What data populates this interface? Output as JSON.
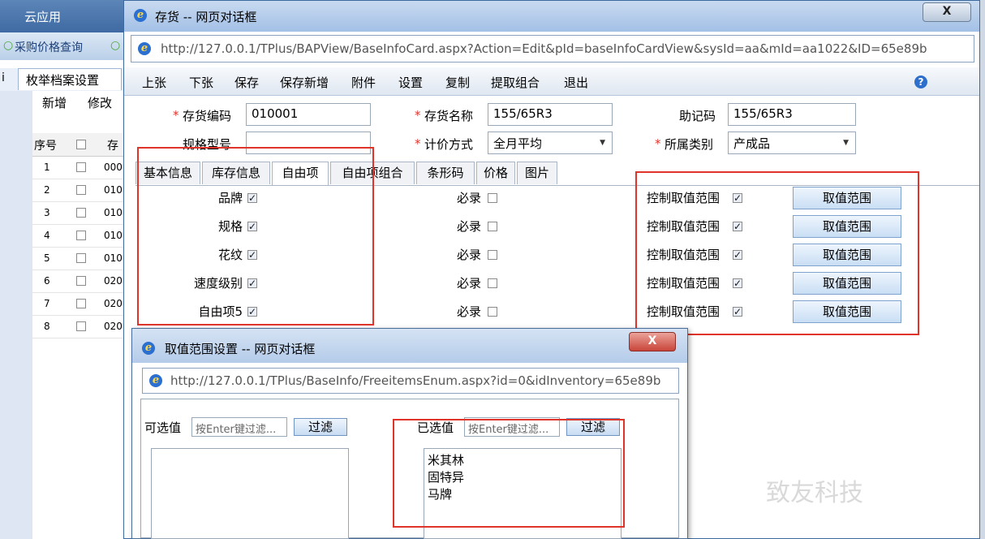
{
  "background_app": {
    "title": "云应用",
    "tab1": "采购价格查询",
    "tab2": "○",
    "left_label": "i",
    "subtab": "枚举档案设置",
    "actions": [
      "新增",
      "修改"
    ],
    "grid_header": {
      "seq": "序号",
      "code": "存"
    },
    "rows": [
      {
        "seq": "1",
        "code": "000"
      },
      {
        "seq": "2",
        "code": "010"
      },
      {
        "seq": "3",
        "code": "010"
      },
      {
        "seq": "4",
        "code": "010"
      },
      {
        "seq": "5",
        "code": "010"
      },
      {
        "seq": "6",
        "code": "020"
      },
      {
        "seq": "7",
        "code": "020"
      },
      {
        "seq": "8",
        "code": "020"
      }
    ]
  },
  "dialog": {
    "title": "存货 -- 网页对话框",
    "close_label": "X",
    "url": "http://127.0.0.1/TPlus/BAPView/BaseInfoCard.aspx?Action=Edit&pId=baseInfoCardView&sysId=aa&mId=aa1022&ID=65e89b",
    "toolbar": [
      "上张",
      "下张",
      "保存",
      "保存新增",
      "附件",
      "设置",
      "复制",
      "提取组合",
      "退出"
    ],
    "help": "?",
    "form": {
      "code_label": "存货编码",
      "code_value": "010001",
      "name_label": "存货名称",
      "name_value": "155/65R3",
      "mnemonic_label": "助记码",
      "mnemonic_value": "155/65R3",
      "spec_label": "规格型号",
      "spec_value": "",
      "valuation_label": "计价方式",
      "valuation_value": "全月平均",
      "category_label": "所属类别",
      "category_value": "产成品",
      "required_mark": "*"
    },
    "tabs": [
      "基本信息",
      "库存信息",
      "自由项",
      "自由项组合",
      "条形码",
      "价格",
      "图片"
    ],
    "active_tab": "自由项",
    "free_items": [
      {
        "name": "品牌",
        "enabled": true,
        "required_label": "必录",
        "required": false,
        "control_label": "控制取值范围",
        "control": true,
        "button": "取值范围"
      },
      {
        "name": "规格",
        "enabled": true,
        "required_label": "必录",
        "required": false,
        "control_label": "控制取值范围",
        "control": true,
        "button": "取值范围"
      },
      {
        "name": "花纹",
        "enabled": true,
        "required_label": "必录",
        "required": false,
        "control_label": "控制取值范围",
        "control": true,
        "button": "取值范围"
      },
      {
        "name": "速度级别",
        "enabled": true,
        "required_label": "必录",
        "required": false,
        "control_label": "控制取值范围",
        "control": true,
        "button": "取值范围"
      },
      {
        "name": "自由项5",
        "enabled": true,
        "required_label": "必录",
        "required": false,
        "control_label": "控制取值范围",
        "control": true,
        "button": "取值范围"
      }
    ]
  },
  "range_dialog": {
    "title": "取值范围设置 -- 网页对话框",
    "close_label": "X",
    "url": "http://127.0.0.1/TPlus/BaseInfo/FreeitemsEnum.aspx?id=0&idInventory=65e89b",
    "available_label": "可选值",
    "selected_label": "已选值",
    "filter_placeholder": "按Enter键过滤...",
    "filter_button": "过滤",
    "selected_values": [
      "米其林",
      "固特异",
      "马牌"
    ]
  },
  "watermark": "致友科技",
  "colors": {
    "highlight_red": "#e0342b",
    "title_blue": "#a3c0e6"
  }
}
